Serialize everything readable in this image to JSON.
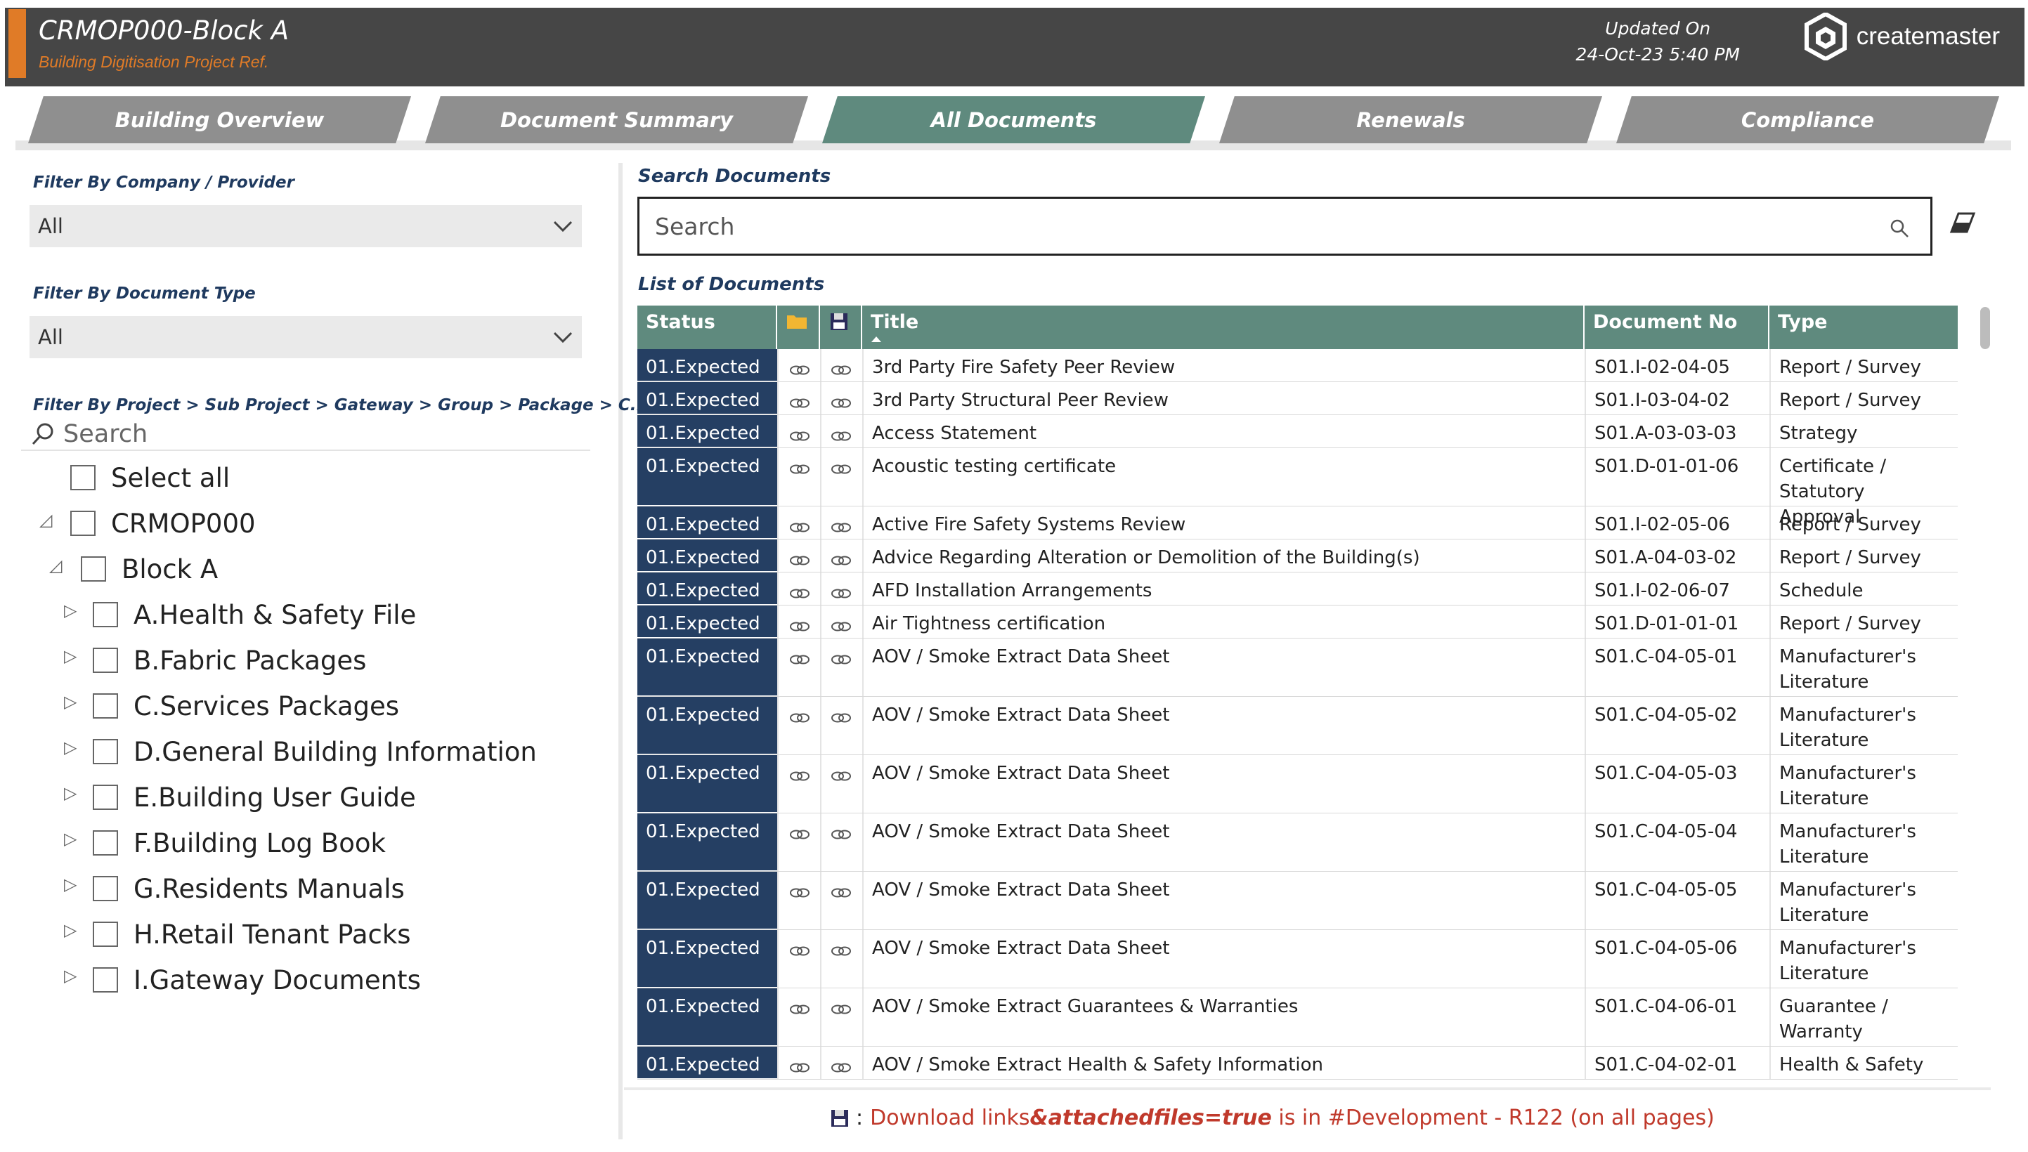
{
  "header": {
    "title": "CRMOP000-Block A",
    "subtitle": "Building Digitisation Project Ref.",
    "updated_label": "Updated On",
    "updated_value": "24-Oct-23 5:40 PM",
    "logo_text": "createmaster",
    "accent_color": "#e07b27",
    "background": "#464646"
  },
  "tabs": [
    {
      "label": "Building Overview",
      "active": false
    },
    {
      "label": "Document Summary",
      "active": false
    },
    {
      "label": "All Documents",
      "active": true
    },
    {
      "label": "Renewals",
      "active": false
    },
    {
      "label": "Compliance",
      "active": false
    }
  ],
  "filters": {
    "company_label": "Filter By Company / Provider",
    "company_value": "All",
    "doctype_label": "Filter By Document Type",
    "doctype_value": "All",
    "project_label": "Filter By Project > Sub Project > Gateway > Group > Package > C...",
    "project_search_placeholder": "Search",
    "tree": [
      {
        "label": "Select all",
        "expander": false
      },
      {
        "label": "CRMOP000",
        "expander": "expanded"
      },
      {
        "label": "Block A",
        "expander": "expanded"
      },
      {
        "label": "A.Health & Safety File",
        "expander": "collapsed"
      },
      {
        "label": "B.Fabric Packages",
        "expander": "collapsed"
      },
      {
        "label": "C.Services Packages",
        "expander": "collapsed"
      },
      {
        "label": "D.General Building Information",
        "expander": "collapsed"
      },
      {
        "label": "E.Building User Guide",
        "expander": "collapsed"
      },
      {
        "label": "F.Building Log Book",
        "expander": "collapsed"
      },
      {
        "label": "G.Residents Manuals",
        "expander": "collapsed"
      },
      {
        "label": "H.Retail Tenant Packs",
        "expander": "collapsed"
      },
      {
        "label": "I.Gateway Documents",
        "expander": "collapsed"
      }
    ]
  },
  "search": {
    "label": "Search Documents",
    "placeholder": "Search"
  },
  "list": {
    "label": "List of Documents",
    "columns": {
      "status": "Status",
      "title": "Title",
      "docno": "Document No",
      "type": "Type"
    },
    "header_color": "#5f8a7e",
    "status_color": "#253f63",
    "rows": [
      {
        "status": "01.Expected",
        "title": "3rd Party Fire Safety Peer Review",
        "docno": "S01.I-02-04-05",
        "type": [
          "Report / Survey"
        ]
      },
      {
        "status": "01.Expected",
        "title": "3rd Party Structural Peer Review",
        "docno": "S01.I-03-04-02",
        "type": [
          "Report / Survey"
        ]
      },
      {
        "status": "01.Expected",
        "title": "Access Statement",
        "docno": "S01.A-03-03-03",
        "type": [
          "Strategy"
        ]
      },
      {
        "status": "01.Expected",
        "title": "Acoustic testing certificate",
        "docno": "S01.D-01-01-06",
        "type": [
          "Certificate /",
          "Statutory Approval"
        ]
      },
      {
        "status": "01.Expected",
        "title": "Active Fire Safety Systems Review",
        "docno": "S01.I-02-05-06",
        "type": [
          "Report / Survey"
        ]
      },
      {
        "status": "01.Expected",
        "title": "Advice Regarding Alteration or Demolition of the Building(s)",
        "docno": "S01.A-04-03-02",
        "type": [
          "Report / Survey"
        ]
      },
      {
        "status": "01.Expected",
        "title": "AFD Installation Arrangements",
        "docno": "S01.I-02-06-07",
        "type": [
          "Schedule"
        ]
      },
      {
        "status": "01.Expected",
        "title": "Air Tightness certification",
        "docno": "S01.D-01-01-01",
        "type": [
          "Report / Survey"
        ]
      },
      {
        "status": "01.Expected",
        "title": "AOV / Smoke Extract Data Sheet",
        "docno": "S01.C-04-05-01",
        "type": [
          "Manufacturer's",
          "Literature"
        ]
      },
      {
        "status": "01.Expected",
        "title": "AOV / Smoke Extract Data Sheet",
        "docno": "S01.C-04-05-02",
        "type": [
          "Manufacturer's",
          "Literature"
        ]
      },
      {
        "status": "01.Expected",
        "title": "AOV / Smoke Extract Data Sheet",
        "docno": "S01.C-04-05-03",
        "type": [
          "Manufacturer's",
          "Literature"
        ]
      },
      {
        "status": "01.Expected",
        "title": "AOV / Smoke Extract Data Sheet",
        "docno": "S01.C-04-05-04",
        "type": [
          "Manufacturer's",
          "Literature"
        ]
      },
      {
        "status": "01.Expected",
        "title": "AOV / Smoke Extract Data Sheet",
        "docno": "S01.C-04-05-05",
        "type": [
          "Manufacturer's",
          "Literature"
        ]
      },
      {
        "status": "01.Expected",
        "title": "AOV / Smoke Extract Data Sheet",
        "docno": "S01.C-04-05-06",
        "type": [
          "Manufacturer's",
          "Literature"
        ]
      },
      {
        "status": "01.Expected",
        "title": "AOV / Smoke Extract Guarantees & Warranties",
        "docno": "S01.C-04-06-01",
        "type": [
          "Guarantee /",
          "Warranty"
        ]
      },
      {
        "status": "01.Expected",
        "title": "AOV / Smoke Extract Health & Safety Information",
        "docno": "S01.C-04-02-01",
        "type": [
          "Health & Safety"
        ]
      }
    ]
  },
  "footer_note": {
    "prefix": ":",
    "text1": "Download links ",
    "bold": "&attachedfiles=true",
    "text2": " is in #Development - R122 (on all pages)"
  }
}
